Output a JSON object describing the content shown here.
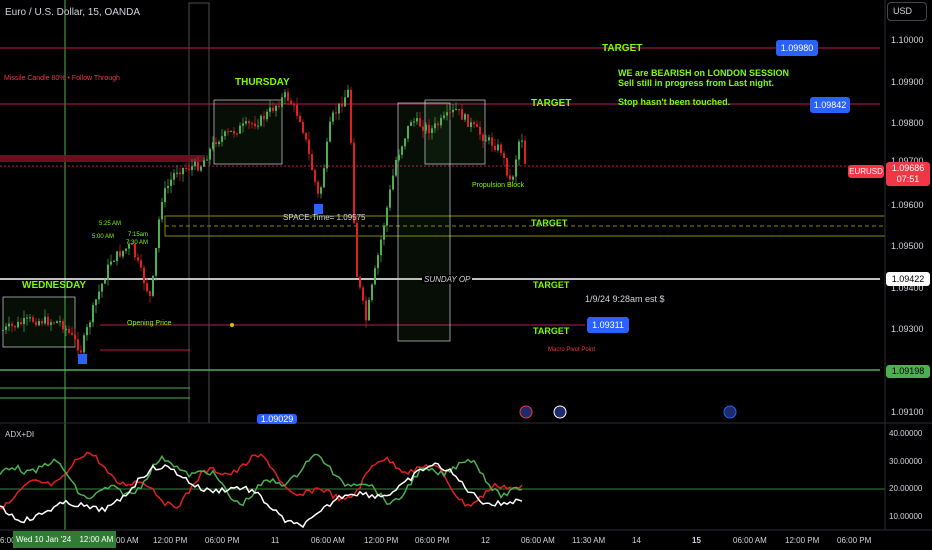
{
  "header": {
    "symbol_title": "Euro / U.S. Dollar, 15, OANDA",
    "currency_button": "USD"
  },
  "price_axis": {
    "ticks": [
      "1.10000",
      "1.09900",
      "1.09800",
      "1.09700",
      "1.09600",
      "1.09500",
      "1.09400",
      "1.09300",
      "1.09100"
    ],
    "labels": {
      "blue_top": "1.09980",
      "blue_mid": "1.09842",
      "red_symbol": "EURUSD",
      "red_price": "1.09686",
      "red_timer": "07:51",
      "white_line": "1.09422",
      "blue_low": "1.09311",
      "green_line": "1.09198",
      "blue_bottom": "1.09029"
    }
  },
  "annotations": {
    "missile_candle": "Missile Candle 80% • Follow Through",
    "thursday": "THURSDAY",
    "wednesday": "WEDNESDAY",
    "target_1": "TARGET",
    "target_2": "TARGET",
    "target_3": "TARGET",
    "target_4": "TARGET",
    "target_5": "TARGET",
    "note_bearish": "WE are BEARISH on LONDON SESSION",
    "note_sell": "Sell still in progress from Last night.",
    "note_stop": "Stop hasn't been touched.",
    "propulsion": "Propulsion Block",
    "space_time": "SPACE-Time= 1.09575",
    "sunday_op": "SUNDAY OP",
    "timestamp_note": "1/9/24 9:28am est $",
    "opening_price": "Opening Price",
    "macro_pivot": "Macro Pivot Point",
    "time_525": "5:25 AM",
    "time_600": "5:00 AM",
    "time_715": "7:15am",
    "time_730": "7:30 AM"
  },
  "indicator": {
    "name": "ADX+DI",
    "ticks": [
      "40.00000",
      "30.00000",
      "20.00000",
      "10.00000"
    ],
    "level_label": "20.00000"
  },
  "time_axis": {
    "start_fragment": "6:00",
    "highlight_label": "Wed 10 Jan '24",
    "highlight_time": "12:00 AM",
    "ticks": [
      "12:00 PM",
      "06:00 PM",
      "11",
      "06:00 AM",
      "12:00 PM",
      "06:00 PM",
      "12",
      "06:00 AM",
      "11:30 AM",
      "14",
      "15",
      "06:00 AM",
      "12:00 PM",
      "06:00 PM"
    ],
    "first_partial": "00 AM"
  },
  "colors": {
    "background": "#000000",
    "accent_green": "#4caf50",
    "target_green": "#7cfc00",
    "bull_candle": "#4caf50",
    "bear_candle": "#e02020",
    "price_blue": "#2962ff",
    "price_red": "#f23645",
    "pink_line": "#c2185b",
    "yellow_line": "#c9c900"
  }
}
